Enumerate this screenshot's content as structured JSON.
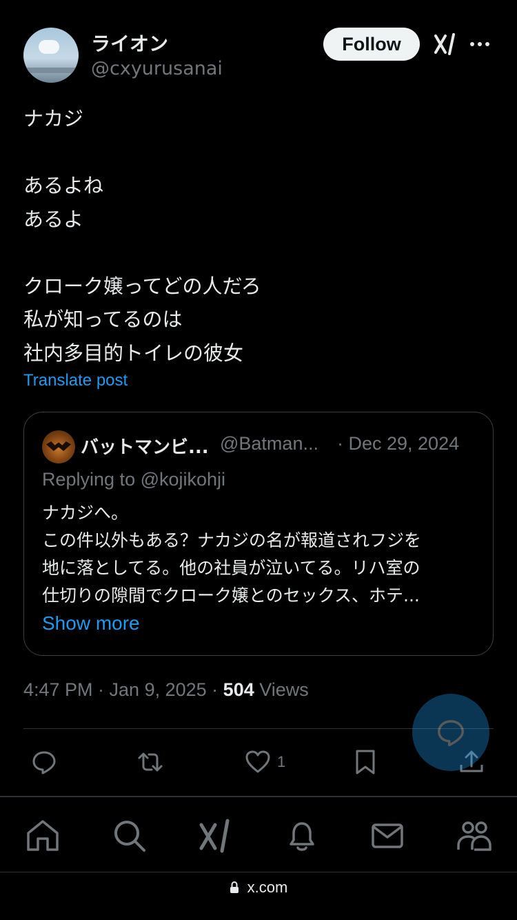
{
  "post": {
    "author_name": "ライオン",
    "author_handle": "@cxyurusanai",
    "follow_label": "Follow",
    "text": "ナカジ\n\nあるよね\nあるよ\n\nクローク嬢ってどの人だろ\n私が知ってるのは\n社内多目的トイレの彼女",
    "translate_label": "Translate post",
    "time": "4:47 PM · Jan 9, 2025 · ",
    "views_count": "504",
    "views_label": " Views"
  },
  "quote": {
    "author_name": "バットマンビ...",
    "author_handle": "@Batman...",
    "date": "· Dec 29, 2024",
    "replying_to": "Replying to @kojikohji",
    "text": "ナカジへ。\nこの件以外もある？ナカジの名が報道されフジを\n地に落としてる。他の社員が泣いてる。リハ室の\n仕切りの隙間でクローク嬢とのセックス、ホテ...",
    "show_more": "Show more"
  },
  "actions": {
    "reply_icon": "reply-icon",
    "repost_icon": "repost-icon",
    "like_icon": "like-icon",
    "like_count": "1",
    "bookmark_icon": "bookmark-icon",
    "share_icon": "share-icon"
  },
  "tabbar": [
    "home-icon",
    "search-icon",
    "grok-icon",
    "notifications-icon",
    "messages-icon",
    "communities-icon"
  ],
  "browser": {
    "url": "x.com"
  },
  "colors": {
    "background": "#000000",
    "accent": "#1d9bf0",
    "secondary_text": "#71767b"
  }
}
